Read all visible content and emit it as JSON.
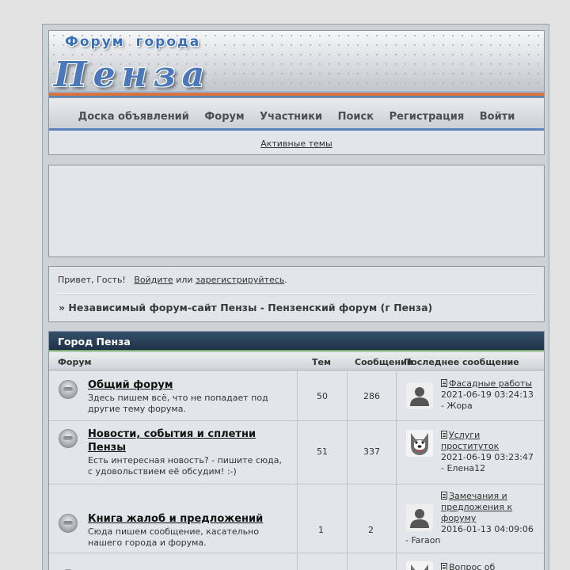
{
  "header": {
    "subtitle": "Форум города",
    "title": "Пенза"
  },
  "nav": {
    "items": [
      "Доска объявлений",
      "Форум",
      "Участники",
      "Поиск",
      "Регистрация",
      "Войти"
    ],
    "sub_link": "Активные темы"
  },
  "welcome": {
    "greeting": "Привет, Гость!",
    "login": "Войдите",
    "or": "или",
    "register": "зарегистрируйтесь",
    "period": ".",
    "breadcrumb": "» Независимый форум-сайт Пензы - Пензенский форум (г Пенза)"
  },
  "category": {
    "title": "Город Пенза",
    "columns": {
      "forum": "Форум",
      "topics": "Тем",
      "posts": "Сообщений",
      "last_post": "Последнее сообщение"
    },
    "forums": [
      {
        "name": "Общий форум",
        "desc": "Здесь пишем всё, что не попадает под другие тему форума.",
        "topics": "50",
        "posts": "286",
        "avatar": "default-user-avatar",
        "last_title": "Фасадные работы",
        "last_time": "2021-06-19 03:24:13",
        "last_author": "- Жора"
      },
      {
        "name": "Новости, события и сплетни Пензы",
        "desc": "Есть интересная новость? - пишите сюда, с удовольствием её обсудим! :-)",
        "topics": "51",
        "posts": "337",
        "avatar": "husky-dog-avatar",
        "last_title": "Услуги проституток",
        "last_time": "2021-06-19 03:23:47",
        "last_author": "- Елена12"
      },
      {
        "name": "Книга жалоб и предложений",
        "desc": "Сюда пишем сообщение, касательно нашего города и форума.",
        "topics": "1",
        "posts": "2",
        "avatar": "default-user-avatar",
        "last_title": "Замечания и предложения к форуму",
        "last_time": "2016-01-13 04:09:06",
        "last_author": "- Faraon"
      },
      {
        "name": "",
        "desc": "",
        "topics": "",
        "posts": "",
        "avatar": "husky-dog-avatar",
        "last_title": "Вопрос об",
        "last_time": "",
        "last_author": ""
      }
    ]
  },
  "colors": {
    "page_bg": "#e3e3e3",
    "panel_bg": "#e2e5e9",
    "category_header": "#2a4158",
    "nav_blue": "#5b84be",
    "orange_stripe": "#d6753e"
  }
}
